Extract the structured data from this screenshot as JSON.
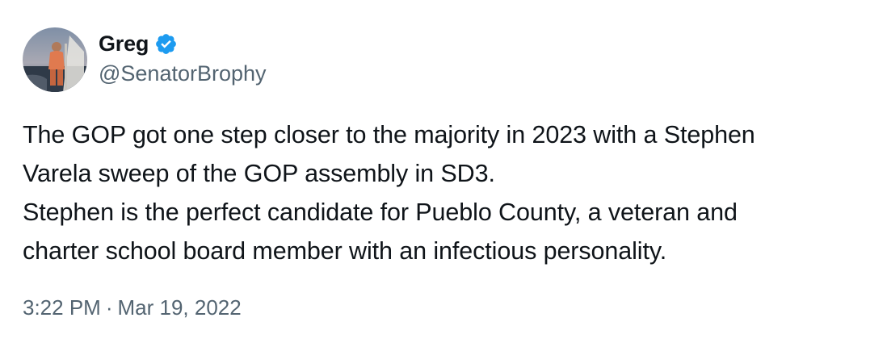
{
  "author": {
    "display_name": "Greg",
    "handle": "@SenatorBrophy",
    "verified": true,
    "verified_icon": "verified-badge-icon",
    "verified_color": "#1d9bf0"
  },
  "tweet": {
    "lines": [
      "The GOP got one step closer to the majority in 2023 with a Stephen",
      "Varela sweep of the GOP assembly in SD3.",
      "Stephen is the perfect candidate for Pueblo County, a veteran and",
      "charter school board member with an infectious personality."
    ]
  },
  "meta": {
    "time": "3:22 PM",
    "separator": "·",
    "date": "Mar 19, 2022"
  }
}
